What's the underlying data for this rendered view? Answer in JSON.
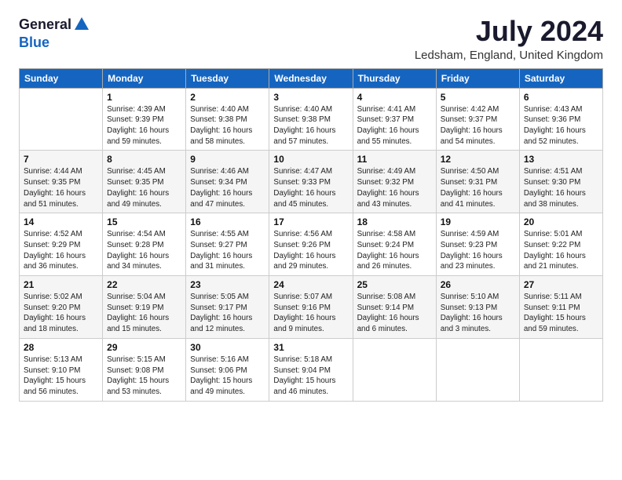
{
  "header": {
    "logo_general": "General",
    "logo_blue": "Blue",
    "month_title": "July 2024",
    "location": "Ledsham, England, United Kingdom"
  },
  "columns": [
    "Sunday",
    "Monday",
    "Tuesday",
    "Wednesday",
    "Thursday",
    "Friday",
    "Saturday"
  ],
  "weeks": [
    [
      {
        "day": "",
        "info": ""
      },
      {
        "day": "1",
        "info": "Sunrise: 4:39 AM\nSunset: 9:39 PM\nDaylight: 16 hours\nand 59 minutes."
      },
      {
        "day": "2",
        "info": "Sunrise: 4:40 AM\nSunset: 9:38 PM\nDaylight: 16 hours\nand 58 minutes."
      },
      {
        "day": "3",
        "info": "Sunrise: 4:40 AM\nSunset: 9:38 PM\nDaylight: 16 hours\nand 57 minutes."
      },
      {
        "day": "4",
        "info": "Sunrise: 4:41 AM\nSunset: 9:37 PM\nDaylight: 16 hours\nand 55 minutes."
      },
      {
        "day": "5",
        "info": "Sunrise: 4:42 AM\nSunset: 9:37 PM\nDaylight: 16 hours\nand 54 minutes."
      },
      {
        "day": "6",
        "info": "Sunrise: 4:43 AM\nSunset: 9:36 PM\nDaylight: 16 hours\nand 52 minutes."
      }
    ],
    [
      {
        "day": "7",
        "info": "Sunrise: 4:44 AM\nSunset: 9:35 PM\nDaylight: 16 hours\nand 51 minutes."
      },
      {
        "day": "8",
        "info": "Sunrise: 4:45 AM\nSunset: 9:35 PM\nDaylight: 16 hours\nand 49 minutes."
      },
      {
        "day": "9",
        "info": "Sunrise: 4:46 AM\nSunset: 9:34 PM\nDaylight: 16 hours\nand 47 minutes."
      },
      {
        "day": "10",
        "info": "Sunrise: 4:47 AM\nSunset: 9:33 PM\nDaylight: 16 hours\nand 45 minutes."
      },
      {
        "day": "11",
        "info": "Sunrise: 4:49 AM\nSunset: 9:32 PM\nDaylight: 16 hours\nand 43 minutes."
      },
      {
        "day": "12",
        "info": "Sunrise: 4:50 AM\nSunset: 9:31 PM\nDaylight: 16 hours\nand 41 minutes."
      },
      {
        "day": "13",
        "info": "Sunrise: 4:51 AM\nSunset: 9:30 PM\nDaylight: 16 hours\nand 38 minutes."
      }
    ],
    [
      {
        "day": "14",
        "info": "Sunrise: 4:52 AM\nSunset: 9:29 PM\nDaylight: 16 hours\nand 36 minutes."
      },
      {
        "day": "15",
        "info": "Sunrise: 4:54 AM\nSunset: 9:28 PM\nDaylight: 16 hours\nand 34 minutes."
      },
      {
        "day": "16",
        "info": "Sunrise: 4:55 AM\nSunset: 9:27 PM\nDaylight: 16 hours\nand 31 minutes."
      },
      {
        "day": "17",
        "info": "Sunrise: 4:56 AM\nSunset: 9:26 PM\nDaylight: 16 hours\nand 29 minutes."
      },
      {
        "day": "18",
        "info": "Sunrise: 4:58 AM\nSunset: 9:24 PM\nDaylight: 16 hours\nand 26 minutes."
      },
      {
        "day": "19",
        "info": "Sunrise: 4:59 AM\nSunset: 9:23 PM\nDaylight: 16 hours\nand 23 minutes."
      },
      {
        "day": "20",
        "info": "Sunrise: 5:01 AM\nSunset: 9:22 PM\nDaylight: 16 hours\nand 21 minutes."
      }
    ],
    [
      {
        "day": "21",
        "info": "Sunrise: 5:02 AM\nSunset: 9:20 PM\nDaylight: 16 hours\nand 18 minutes."
      },
      {
        "day": "22",
        "info": "Sunrise: 5:04 AM\nSunset: 9:19 PM\nDaylight: 16 hours\nand 15 minutes."
      },
      {
        "day": "23",
        "info": "Sunrise: 5:05 AM\nSunset: 9:17 PM\nDaylight: 16 hours\nand 12 minutes."
      },
      {
        "day": "24",
        "info": "Sunrise: 5:07 AM\nSunset: 9:16 PM\nDaylight: 16 hours\nand 9 minutes."
      },
      {
        "day": "25",
        "info": "Sunrise: 5:08 AM\nSunset: 9:14 PM\nDaylight: 16 hours\nand 6 minutes."
      },
      {
        "day": "26",
        "info": "Sunrise: 5:10 AM\nSunset: 9:13 PM\nDaylight: 16 hours\nand 3 minutes."
      },
      {
        "day": "27",
        "info": "Sunrise: 5:11 AM\nSunset: 9:11 PM\nDaylight: 15 hours\nand 59 minutes."
      }
    ],
    [
      {
        "day": "28",
        "info": "Sunrise: 5:13 AM\nSunset: 9:10 PM\nDaylight: 15 hours\nand 56 minutes."
      },
      {
        "day": "29",
        "info": "Sunrise: 5:15 AM\nSunset: 9:08 PM\nDaylight: 15 hours\nand 53 minutes."
      },
      {
        "day": "30",
        "info": "Sunrise: 5:16 AM\nSunset: 9:06 PM\nDaylight: 15 hours\nand 49 minutes."
      },
      {
        "day": "31",
        "info": "Sunrise: 5:18 AM\nSunset: 9:04 PM\nDaylight: 15 hours\nand 46 minutes."
      },
      {
        "day": "",
        "info": ""
      },
      {
        "day": "",
        "info": ""
      },
      {
        "day": "",
        "info": ""
      }
    ]
  ]
}
